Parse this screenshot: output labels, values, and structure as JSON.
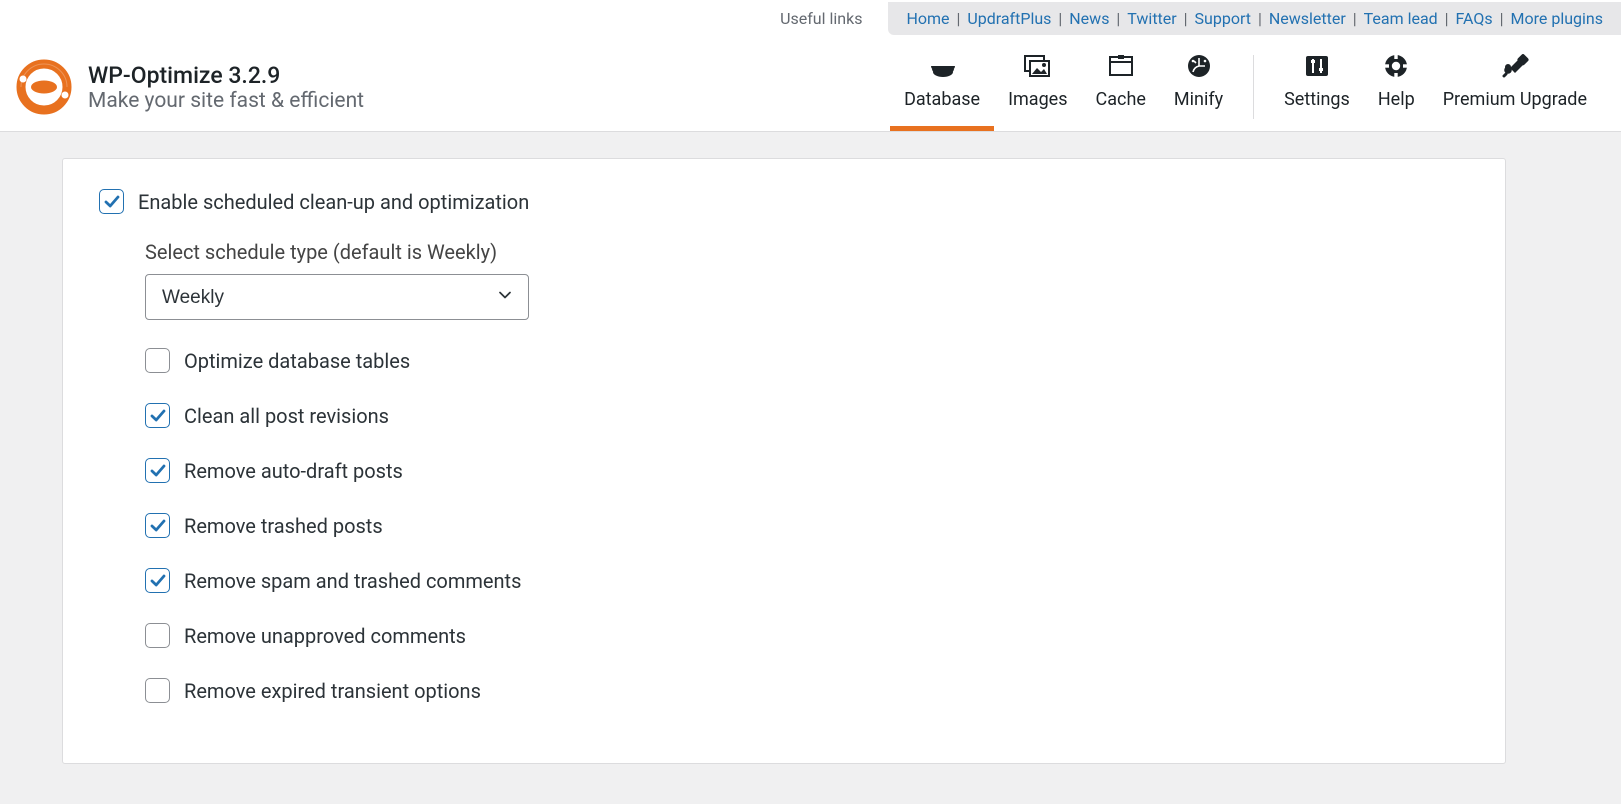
{
  "top": {
    "useful_links": "Useful links",
    "links": [
      "Home",
      "UpdraftPlus",
      "News",
      "Twitter",
      "Support",
      "Newsletter",
      "Team lead",
      "FAQs",
      "More plugins"
    ]
  },
  "header": {
    "title": "WP-Optimize 3.2.9",
    "subtitle": "Make your site fast & efficient",
    "tabs": [
      {
        "id": "database",
        "label": "Database",
        "active": true
      },
      {
        "id": "images",
        "label": "Images"
      },
      {
        "id": "cache",
        "label": "Cache"
      },
      {
        "id": "minify",
        "label": "Minify"
      },
      {
        "id": "settings",
        "label": "Settings"
      },
      {
        "id": "help",
        "label": "Help"
      },
      {
        "id": "premium",
        "label": "Premium Upgrade"
      }
    ]
  },
  "main": {
    "enable": {
      "checked": true,
      "label": "Enable scheduled clean-up and optimization"
    },
    "schedule_label": "Select schedule type (default is Weekly)",
    "schedule_value": "Weekly",
    "options": [
      {
        "id": "optimize-tables",
        "checked": false,
        "label": "Optimize database tables"
      },
      {
        "id": "clean-revisions",
        "checked": true,
        "label": "Clean all post revisions"
      },
      {
        "id": "remove-auto-draft",
        "checked": true,
        "label": "Remove auto-draft posts"
      },
      {
        "id": "remove-trashed-posts",
        "checked": true,
        "label": "Remove trashed posts"
      },
      {
        "id": "remove-spam-comments",
        "checked": true,
        "label": "Remove spam and trashed comments"
      },
      {
        "id": "remove-unapproved-comments",
        "checked": false,
        "label": "Remove unapproved comments"
      },
      {
        "id": "remove-expired-transients",
        "checked": false,
        "label": "Remove expired transient options"
      }
    ]
  }
}
